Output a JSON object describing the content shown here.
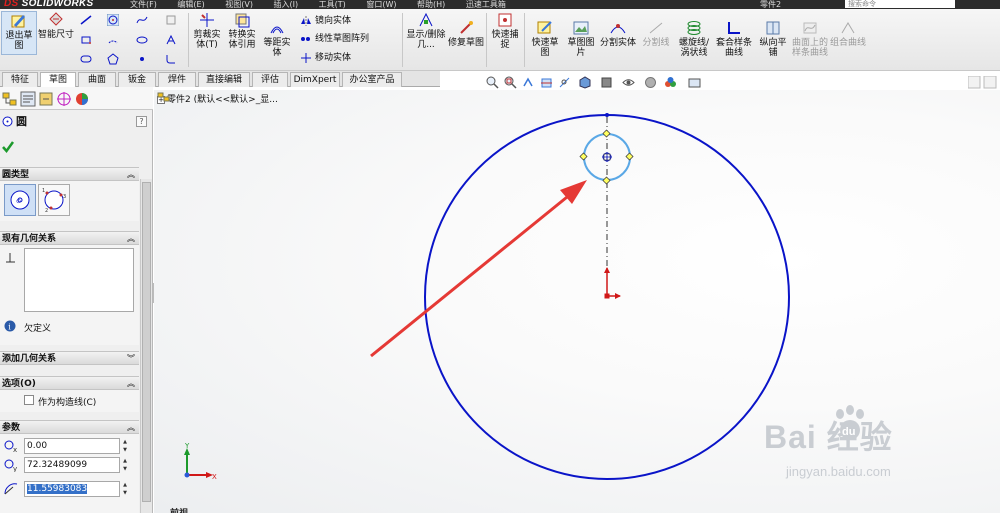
{
  "titlebar": {
    "logo_prefix": "DS",
    "logo_text": "SOLIDWORKS",
    "menu": [
      "文件(F)",
      "编辑(E)",
      "视图(V)",
      "插入(I)",
      "工具(T)",
      "窗口(W)",
      "帮助(H)",
      "迅速工具箱"
    ],
    "document": "零件2",
    "search_placeholder": "搜索命令"
  },
  "ribbon": {
    "exit_sketch": "退出草图",
    "smart_dimension": "智能尺寸",
    "trim": "剪裁实体(T)",
    "convert": "转换实体引用",
    "offset": "等距实体",
    "mirror": "镜向实体",
    "linear_pattern": "线性草图阵列",
    "move": "移动实体",
    "display_delete": "显示/删除几...",
    "repair": "修复草图",
    "quick_snaps": "快速捕捉",
    "rapid_sketch": "快速草图",
    "sketch_picture": "草图图片",
    "split_entity": "分割实体",
    "split_line": "分割线",
    "helix": "螺旋线/涡状线",
    "composite_curve": "套合样条曲线",
    "lofted_plane": "纵向平铺",
    "curve_on_surface": "曲面上的样条曲线",
    "combine_curves": "组合曲线"
  },
  "tabs": [
    "特征",
    "草图",
    "曲面",
    "钣金",
    "焊件",
    "直接编辑",
    "评估",
    "DimXpert",
    "办公室产品"
  ],
  "active_tab": 1,
  "tree": {
    "path": "零件2 (默认<<默认>_显..."
  },
  "pm": {
    "title": "圆",
    "help": "?",
    "circle_type_header": "圆类型",
    "existing_relations_header": "现有几何关系",
    "status": "欠定义",
    "add_relations_header": "添加几何关系",
    "options_header": "选项(O)",
    "construction_label": "作为构造线(C)",
    "params_header": "参数",
    "cx": "0.00",
    "cy": "72.32489099",
    "radius": "11.55983083"
  },
  "viewport": {
    "front_label": "前视",
    "axis_x": "X",
    "axis_y": "Y"
  },
  "watermark": {
    "main": "Bai 经验",
    "du": "du",
    "sub": "jingyan.baidu.com"
  },
  "colors": {
    "sketch_blue": "#0a14c8",
    "selected_blue": "#5aa8e6",
    "arrow_red": "#e53935",
    "accent_red": "#e02020"
  }
}
